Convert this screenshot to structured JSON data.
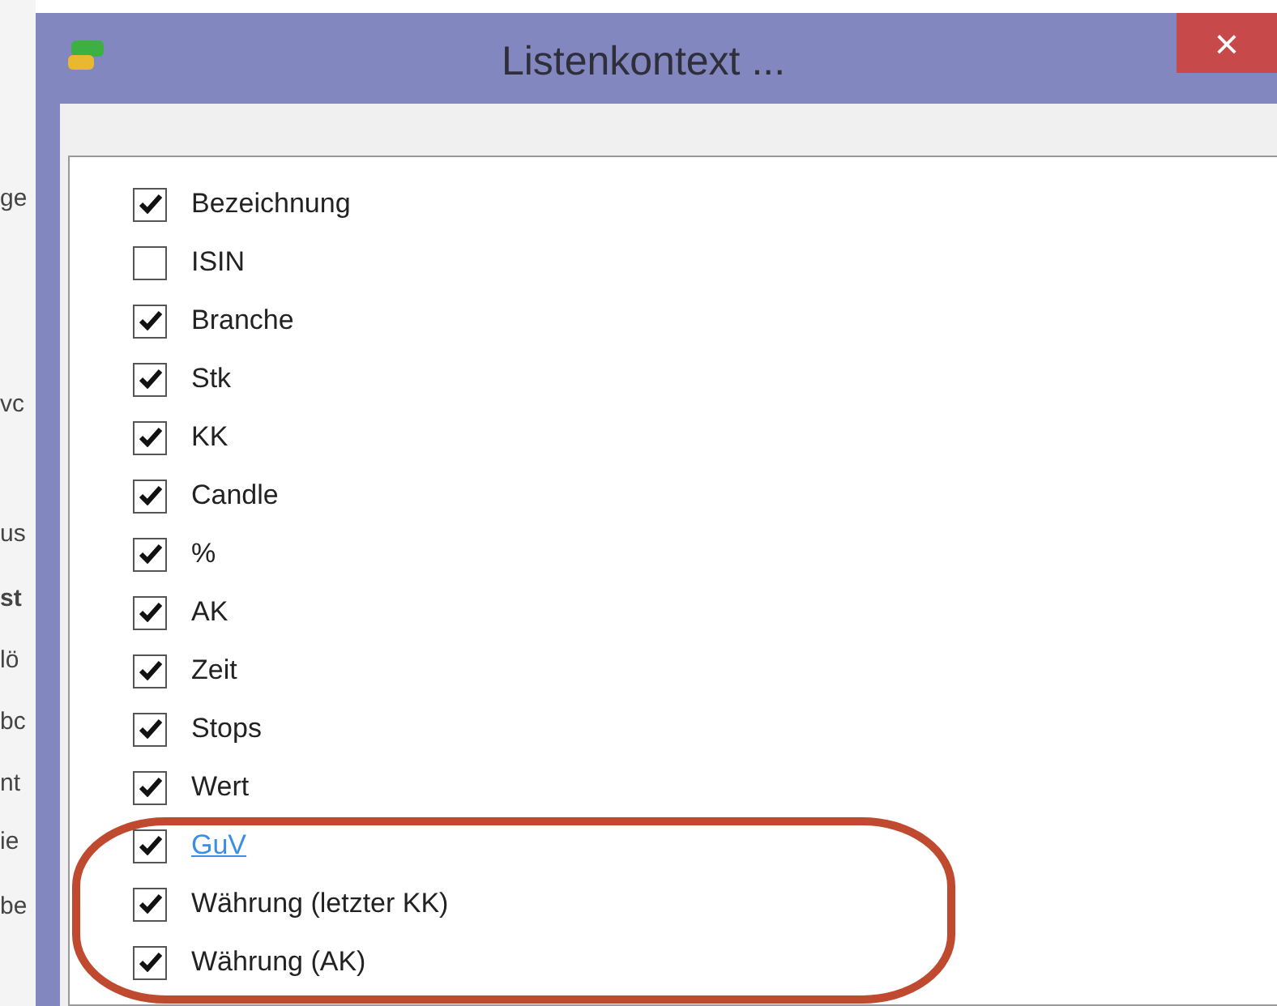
{
  "background_fragments": [
    "ge",
    "vc",
    "us",
    "st",
    "lö",
    "bc",
    "nt",
    "ie",
    "be"
  ],
  "window": {
    "title": "Listenkontext ...",
    "close": "×"
  },
  "items": [
    {
      "label": "Bezeichnung",
      "checked": true,
      "hovered": false
    },
    {
      "label": "ISIN",
      "checked": false,
      "hovered": false
    },
    {
      "label": "Branche",
      "checked": true,
      "hovered": false
    },
    {
      "label": "Stk",
      "checked": true,
      "hovered": false
    },
    {
      "label": "KK",
      "checked": true,
      "hovered": false
    },
    {
      "label": "Candle",
      "checked": true,
      "hovered": false
    },
    {
      "label": "%",
      "checked": true,
      "hovered": false
    },
    {
      "label": "AK",
      "checked": true,
      "hovered": false
    },
    {
      "label": "Zeit",
      "checked": true,
      "hovered": false
    },
    {
      "label": "Stops",
      "checked": true,
      "hovered": false
    },
    {
      "label": "Wert",
      "checked": true,
      "hovered": false
    },
    {
      "label": "GuV",
      "checked": true,
      "hovered": true
    },
    {
      "label": "Währung (letzter KK)",
      "checked": true,
      "hovered": false
    },
    {
      "label": "Währung (AK)",
      "checked": true,
      "hovered": false
    }
  ]
}
